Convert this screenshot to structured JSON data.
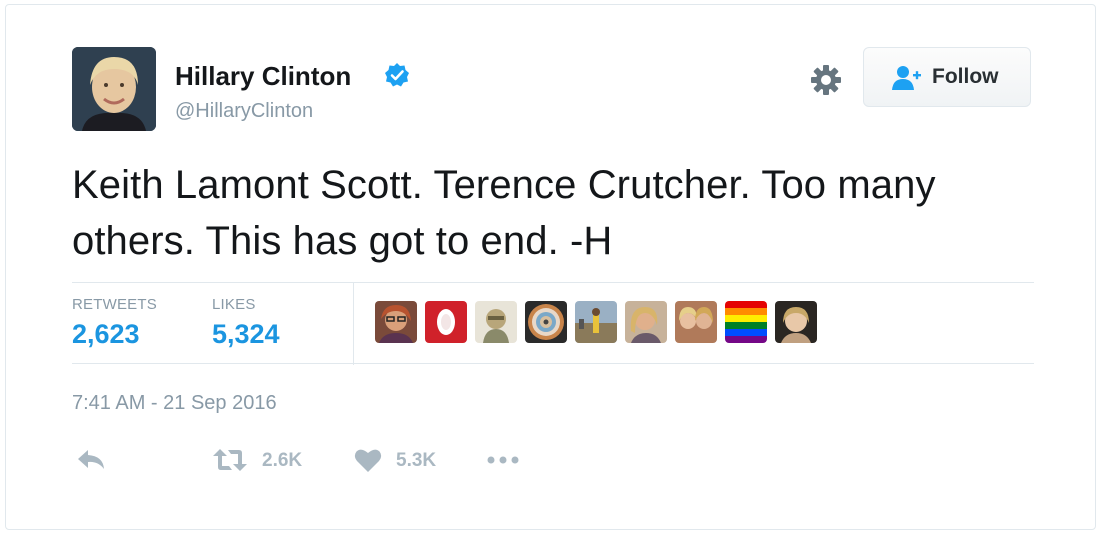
{
  "author": {
    "name": "Hillary Clinton",
    "handle": "@HillaryClinton",
    "verified": true
  },
  "follow_button": {
    "label": "Follow"
  },
  "tweet": {
    "text": "Keith Lamont Scott. Terence Crutcher. Too many others. This has got to end. -H",
    "timestamp": "7:41 AM - 21 Sep 2016"
  },
  "stats": {
    "retweets_label": "RETWEETS",
    "retweets_value": "2,623",
    "likes_label": "LIKES",
    "likes_value": "5,324"
  },
  "actions": {
    "retweet_count": "2.6K",
    "like_count": "5.3K"
  },
  "likers": [
    {
      "icon": "avatar-woman-glasses-icon"
    },
    {
      "icon": "avatar-red-logo-icon"
    },
    {
      "icon": "avatar-sketch-face-icon"
    },
    {
      "icon": "avatar-circular-pattern-icon"
    },
    {
      "icon": "avatar-outdoor-person-icon"
    },
    {
      "icon": "avatar-blonde-woman-icon"
    },
    {
      "icon": "avatar-two-women-icon"
    },
    {
      "icon": "avatar-rainbow-flag-icon"
    },
    {
      "icon": "avatar-woman-portrait-icon"
    }
  ],
  "colors": {
    "link_blue": "#1b95e0",
    "verified_blue": "#1da1f2",
    "muted_gray": "#8899a6",
    "icon_gray": "#aab8c2",
    "border": "#e1e8ed"
  }
}
